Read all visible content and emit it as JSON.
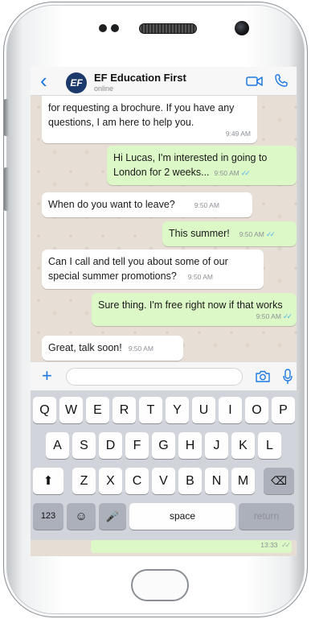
{
  "header": {
    "back_icon": "chevron-left-icon",
    "avatar_text": "EF",
    "contact_name": "EF Education First",
    "contact_status": "online",
    "accent": "#1b78e2"
  },
  "messages": [
    {
      "dir": "in",
      "text": "for requesting a brochure. If you have any questions, I am here to help you.",
      "time": "9:49 AM"
    },
    {
      "dir": "out",
      "text": "Hi Lucas, I'm interested in going to London for 2 weeks...",
      "time": "9:50 AM"
    },
    {
      "dir": "in",
      "text": "When do you want to leave?",
      "time": "9:50 AM"
    },
    {
      "dir": "out",
      "text": "This summer!",
      "time": "9:50 AM"
    },
    {
      "dir": "in",
      "text": "Can I call and tell you about some of our special summer promotions?",
      "time": "9:50 AM"
    },
    {
      "dir": "out",
      "text": "Sure thing. I'm free right now if that works",
      "time": "9:50 AM"
    },
    {
      "dir": "in",
      "text": "Great, talk soon!",
      "time": "9:50 AM"
    }
  ],
  "input": {
    "plus_label": "+",
    "placeholder": ""
  },
  "keyboard": {
    "row1": [
      "Q",
      "W",
      "E",
      "R",
      "T",
      "Y",
      "U",
      "I",
      "O",
      "P"
    ],
    "row2": [
      "A",
      "S",
      "D",
      "F",
      "G",
      "H",
      "J",
      "K",
      "L"
    ],
    "row3": [
      "Z",
      "X",
      "C",
      "V",
      "B",
      "N",
      "M"
    ],
    "numbers_label": "123",
    "space_label": "space",
    "return_label": "return"
  },
  "footer_time": "13:33",
  "colors": {
    "incoming_bubble": "#ffffff",
    "outgoing_bubble": "#dcf8c6",
    "read_ticks": "#4fb6ec"
  }
}
